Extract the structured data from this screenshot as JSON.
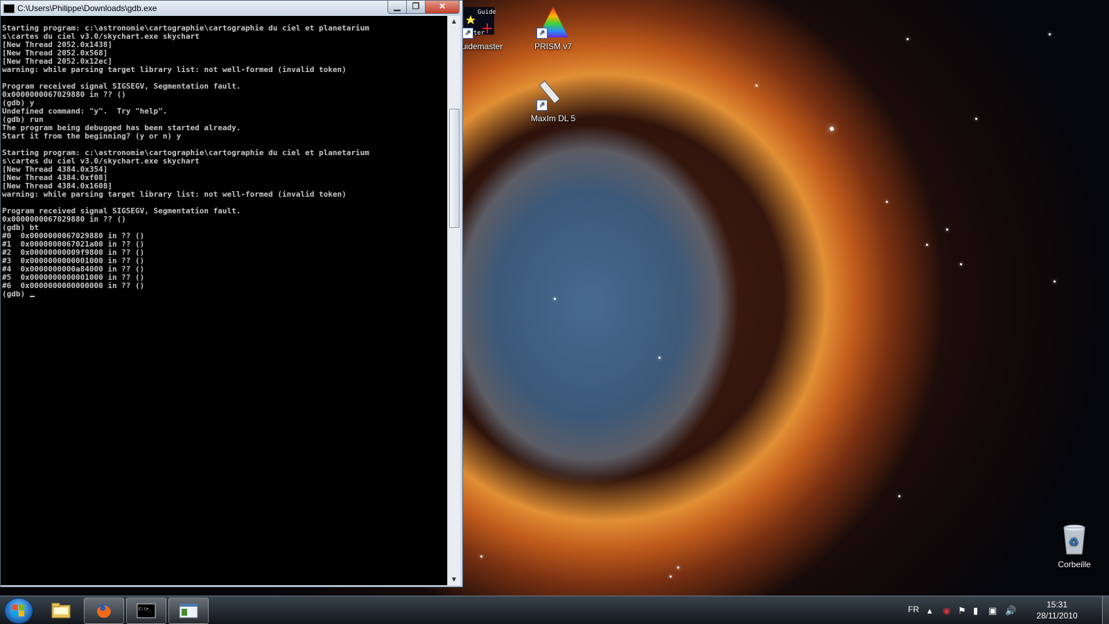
{
  "window": {
    "title": "C:\\Users\\Philippe\\Downloads\\gdb.exe",
    "minimize_glyph": "▁",
    "maximize_glyph": "❐",
    "close_glyph": "✕"
  },
  "console": {
    "lines": [
      "Starting program: c:\\astronomie\\cartographie\\cartographie du ciel et planetarium",
      "s\\cartes du ciel v3.0/skychart.exe skychart",
      "[New Thread 2052.0x1438]",
      "[New Thread 2052.0x568]",
      "[New Thread 2052.0x12ec]",
      "warning: while parsing target library list: not well-formed (invalid token)",
      "",
      "Program received signal SIGSEGV, Segmentation fault.",
      "0x0000000067029880 in ?? ()",
      "(gdb) y",
      "Undefined command: \"y\".  Try \"help\".",
      "(gdb) run",
      "The program being debugged has been started already.",
      "Start it from the beginning? (y or n) y",
      "",
      "Starting program: c:\\astronomie\\cartographie\\cartographie du ciel et planetarium",
      "s\\cartes du ciel v3.0/skychart.exe skychart",
      "[New Thread 4384.0x354]",
      "[New Thread 4384.0xf08]",
      "[New Thread 4384.0x1608]",
      "warning: while parsing target library list: not well-formed (invalid token)",
      "",
      "Program received signal SIGSEGV, Segmentation fault.",
      "0x0000000067029880 in ?? ()",
      "(gdb) bt",
      "#0  0x0000000067029880 in ?? ()",
      "#1  0x0000000067021a00 in ?? ()",
      "#2  0x00000000009f9800 in ?? ()",
      "#3  0x0000000000001000 in ?? ()",
      "#4  0x0000000000a84000 in ?? ()",
      "#5  0x0000000000001000 in ?? ()",
      "#6  0x0000000000000000 in ?? ()"
    ],
    "prompt": "(gdb) "
  },
  "desktop_icons": {
    "guidemaster": {
      "label": "Guidemaster",
      "art_text_top": "Guide",
      "art_text_bottom": "ter",
      "icon": "guidemaster-icon"
    },
    "prism": {
      "label": "PRISM v7",
      "icon": "prism-icon"
    },
    "maxim": {
      "label": "MaxIm DL 5",
      "icon": "telescope-icon"
    },
    "recycle": {
      "label": "Corbeille",
      "icon": "recycle-bin-icon"
    }
  },
  "taskbar": {
    "language": "FR",
    "time": "15:31",
    "date": "28/11/2010",
    "items": [
      "file-explorer-icon",
      "firefox-icon",
      "command-prompt-icon",
      "window-app-icon"
    ],
    "cmd_glyph_text": "C:\\>_"
  },
  "colors": {
    "console_bg": "#000000",
    "console_fg": "#c8c8c8",
    "taskbar": "#1e252c"
  }
}
